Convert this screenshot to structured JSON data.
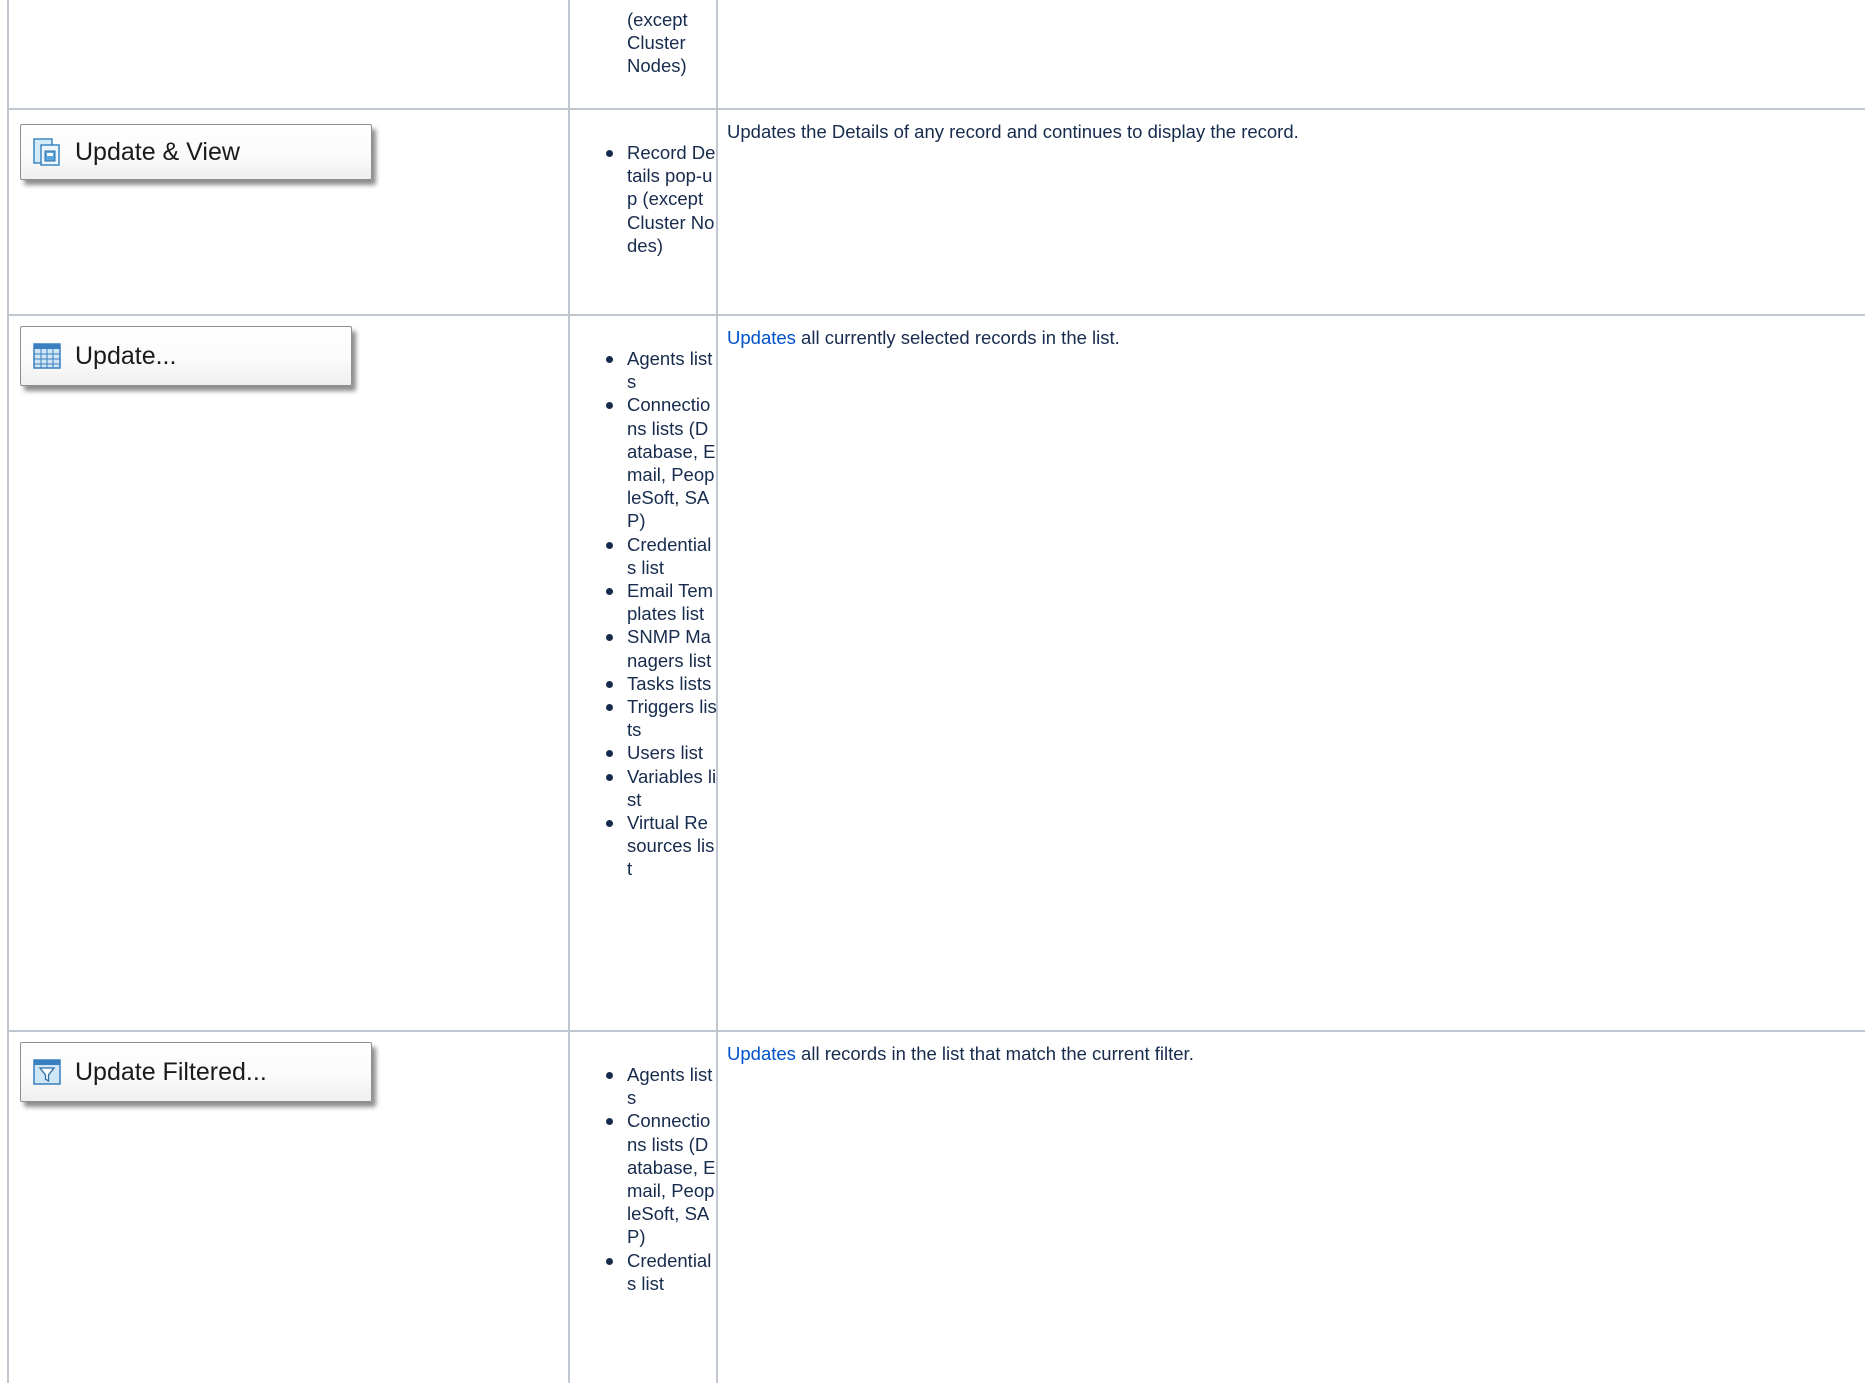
{
  "rows": [
    {
      "id": "previous-row",
      "usage_lines": [
        "(except",
        "Cluster",
        "Nodes)"
      ]
    },
    {
      "id": "update-and-view",
      "button_label": "Update & View",
      "icon": "document-update-icon",
      "usage_items": [
        "Record Details pop-up (except Cluster Nodes)"
      ],
      "description": "Updates the Details of any record and continues to display the record."
    },
    {
      "id": "update",
      "button_label": "Update...",
      "icon": "grid-table-icon",
      "usage_items": [
        "Agents lists",
        "Connections lists (Database, Email, PeopleSoft, SAP)",
        "Credentials list",
        "Email Templates list",
        "SNMP Managers list",
        "Tasks lists",
        "Triggers lists",
        "Users list",
        "Variables list",
        "Virtual Resources list"
      ],
      "description_link": "Updates",
      "description_rest": " all currently selected records in the list."
    },
    {
      "id": "update-filtered",
      "button_label": "Update Filtered...",
      "icon": "filter-icon",
      "usage_items": [
        "Agents lists",
        "Connections lists (Database, Email, PeopleSoft, SAP)",
        "Credentials list"
      ],
      "description_link": "Updates",
      "description_rest": " all records in the list that match the current filter."
    }
  ],
  "colors": {
    "text": "#172b4d",
    "link": "#0052cc",
    "border": "#c1c7d0"
  }
}
